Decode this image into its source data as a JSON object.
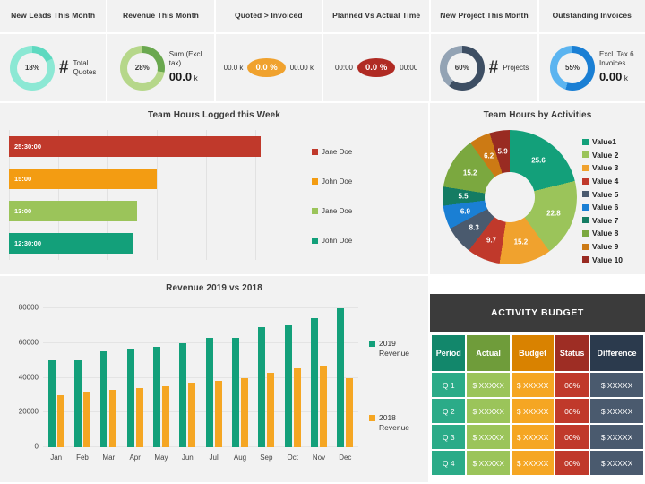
{
  "kpis": [
    {
      "title": "New Leads This Month",
      "type": "gauge",
      "percent": "18%",
      "percent_value": 18,
      "ring_color": "#5ed9c0",
      "track_color": "#8ce8d4",
      "icon": "hash-icon",
      "side_line1": "Total",
      "side_line2": "Quotes"
    },
    {
      "title": "Revenue This Month",
      "type": "gauge",
      "percent": "28%",
      "percent_value": 28,
      "ring_color": "#6aa84f",
      "track_color": "#b6d78a",
      "icon": "",
      "side_line1": "Sum (Excl",
      "side_line2": "tax)",
      "big_value": "00.0",
      "unit": "k"
    },
    {
      "title": "Quoted > Invoiced",
      "type": "pill",
      "left_value": "00.0 k",
      "pill_text": "0.0 %",
      "pill_color": "#f0a22e",
      "right_value": "00.00 k"
    },
    {
      "title": "Planned Vs Actual Time",
      "type": "pill",
      "left_value": "00:00",
      "pill_text": "0.0 %",
      "pill_color": "#b02b24",
      "right_value": "00:00"
    },
    {
      "title": "New Project This Month",
      "type": "gauge",
      "percent": "60%",
      "percent_value": 60,
      "ring_color": "#3d4e63",
      "track_color": "#93a3b4",
      "icon": "hash-icon",
      "side_line1": "Projects",
      "side_line2": ""
    },
    {
      "title": "Outstanding Invoices",
      "type": "gauge",
      "percent": "55%",
      "percent_value": 55,
      "ring_color": "#1a7fd4",
      "track_color": "#5bb4f0",
      "icon": "",
      "side_line1": "Excl. Tax 6",
      "side_line2": "Invoices",
      "big_value": "0.00",
      "unit": "k"
    }
  ],
  "hours_chart": {
    "title": "Team Hours Logged this Week",
    "chart_data": {
      "type": "bar",
      "orientation": "horizontal",
      "title": "Team Hours Logged this Week",
      "categories": [
        "Jane Doe",
        "John Doe",
        "Jane Doe",
        "John Doe"
      ],
      "labels": [
        "25:30:00",
        "15:00",
        "13:00",
        "12:30:00"
      ],
      "values": [
        25.5,
        15.0,
        13.0,
        12.5
      ],
      "colors": [
        "#c0392b",
        "#f39c12",
        "#9bc45a",
        "#13a07a"
      ],
      "xlim": [
        0,
        30
      ],
      "grid": true,
      "legend_position": "right"
    },
    "legend": [
      {
        "label": "Jane Doe",
        "color": "#c0392b"
      },
      {
        "label": "John Doe",
        "color": "#f39c12"
      },
      {
        "label": "Jane Doe",
        "color": "#9bc45a"
      },
      {
        "label": "John Doe",
        "color": "#13a07a"
      }
    ]
  },
  "activities_chart": {
    "title": "Team Hours by Activities",
    "chart_data": {
      "type": "pie",
      "title": "Team Hours by Activities",
      "labels": [
        "Value1",
        "Value 2",
        "Value 3",
        "Value 4",
        "Value 5",
        "Value 6",
        "Value 7",
        "Value 8",
        "Value 9",
        "Value 10"
      ],
      "values": [
        25.6,
        22.8,
        15.2,
        9.7,
        8.3,
        6.9,
        5.5,
        15.2,
        6.2,
        5.9
      ],
      "colors": [
        "#13a07a",
        "#9bc45a",
        "#f0a22e",
        "#c0392b",
        "#4a5a6e",
        "#1a7fd4",
        "#147c63",
        "#7ba83f",
        "#cc7a14",
        "#992b22"
      ],
      "legend_position": "right",
      "donut": true
    },
    "legend": [
      {
        "label": "Value1",
        "color": "#13a07a"
      },
      {
        "label": "Value 2",
        "color": "#9bc45a"
      },
      {
        "label": "Value 3",
        "color": "#f0a22e"
      },
      {
        "label": "Value 4",
        "color": "#c0392b"
      },
      {
        "label": "Value 5",
        "color": "#4a5a6e"
      },
      {
        "label": "Value 6",
        "color": "#1a7fd4"
      },
      {
        "label": "Value 7",
        "color": "#147c63"
      },
      {
        "label": "Value 8",
        "color": "#7ba83f"
      },
      {
        "label": "Value 9",
        "color": "#cc7a14"
      },
      {
        "label": "Value 10",
        "color": "#992b22"
      }
    ]
  },
  "revenue_chart": {
    "title": "Revenue 2019 vs 2018",
    "chart_data": {
      "type": "bar",
      "title": "Revenue 2019 vs 2018",
      "categories": [
        "Jan",
        "Feb",
        "Mar",
        "Apr",
        "May",
        "Jun",
        "Jul",
        "Aug",
        "Sep",
        "Oct",
        "Nov",
        "Dec"
      ],
      "series": [
        {
          "name": "2019 Revenue",
          "color": "#13a07a",
          "values": [
            50000,
            50000,
            55000,
            57000,
            58000,
            60000,
            63000,
            63000,
            69000,
            70000,
            74500,
            80000
          ]
        },
        {
          "name": "2018 Revenue",
          "color": "#f5a623",
          "values": [
            30000,
            32000,
            33000,
            34000,
            35000,
            37000,
            38000,
            40000,
            43000,
            45500,
            47000,
            40000
          ]
        }
      ],
      "yticks": [
        0,
        20000,
        40000,
        60000,
        80000
      ],
      "ylim": [
        0,
        80000
      ],
      "xlabel": "",
      "ylabel": "",
      "grid": true,
      "legend_position": "right"
    },
    "ytick_labels": [
      "80000",
      "60000",
      "40000",
      "20000",
      "0"
    ],
    "legend": [
      {
        "line1": "2019",
        "line2": "Revenue",
        "color": "#13a07a"
      },
      {
        "line1": "2018",
        "line2": "Revenue",
        "color": "#f5a623"
      }
    ]
  },
  "budget_table": {
    "title": "ACTIVITY BUDGET",
    "header_bg": "#3b3b3b",
    "columns": [
      {
        "label": "Period",
        "head_color": "#12876b",
        "cell_color": "#2bab88"
      },
      {
        "label": "Actual",
        "head_color": "#6f9c3a",
        "cell_color": "#9bc45a"
      },
      {
        "label": "Budget",
        "head_color": "#d98200",
        "cell_color": "#f5a623"
      },
      {
        "label": "Status",
        "head_color": "#9e2d24",
        "cell_color": "#c0392b"
      },
      {
        "label": "Difference",
        "head_color": "#2b3a4d",
        "cell_color": "#4a5a6e"
      }
    ],
    "rows": [
      [
        "Q 1",
        "$ XXXXX",
        "$ XXXXX",
        "00%",
        "$ XXXXX"
      ],
      [
        "Q 2",
        "$ XXXXX",
        "$ XXXXX",
        "00%",
        "$ XXXXX"
      ],
      [
        "Q 3",
        "$ XXXXX",
        "$ XXXXX",
        "00%",
        "$ XXXXX"
      ],
      [
        "Q 4",
        "$ XXXXX",
        "$ XXXXX",
        "00%",
        "$ XXXXX"
      ]
    ]
  }
}
